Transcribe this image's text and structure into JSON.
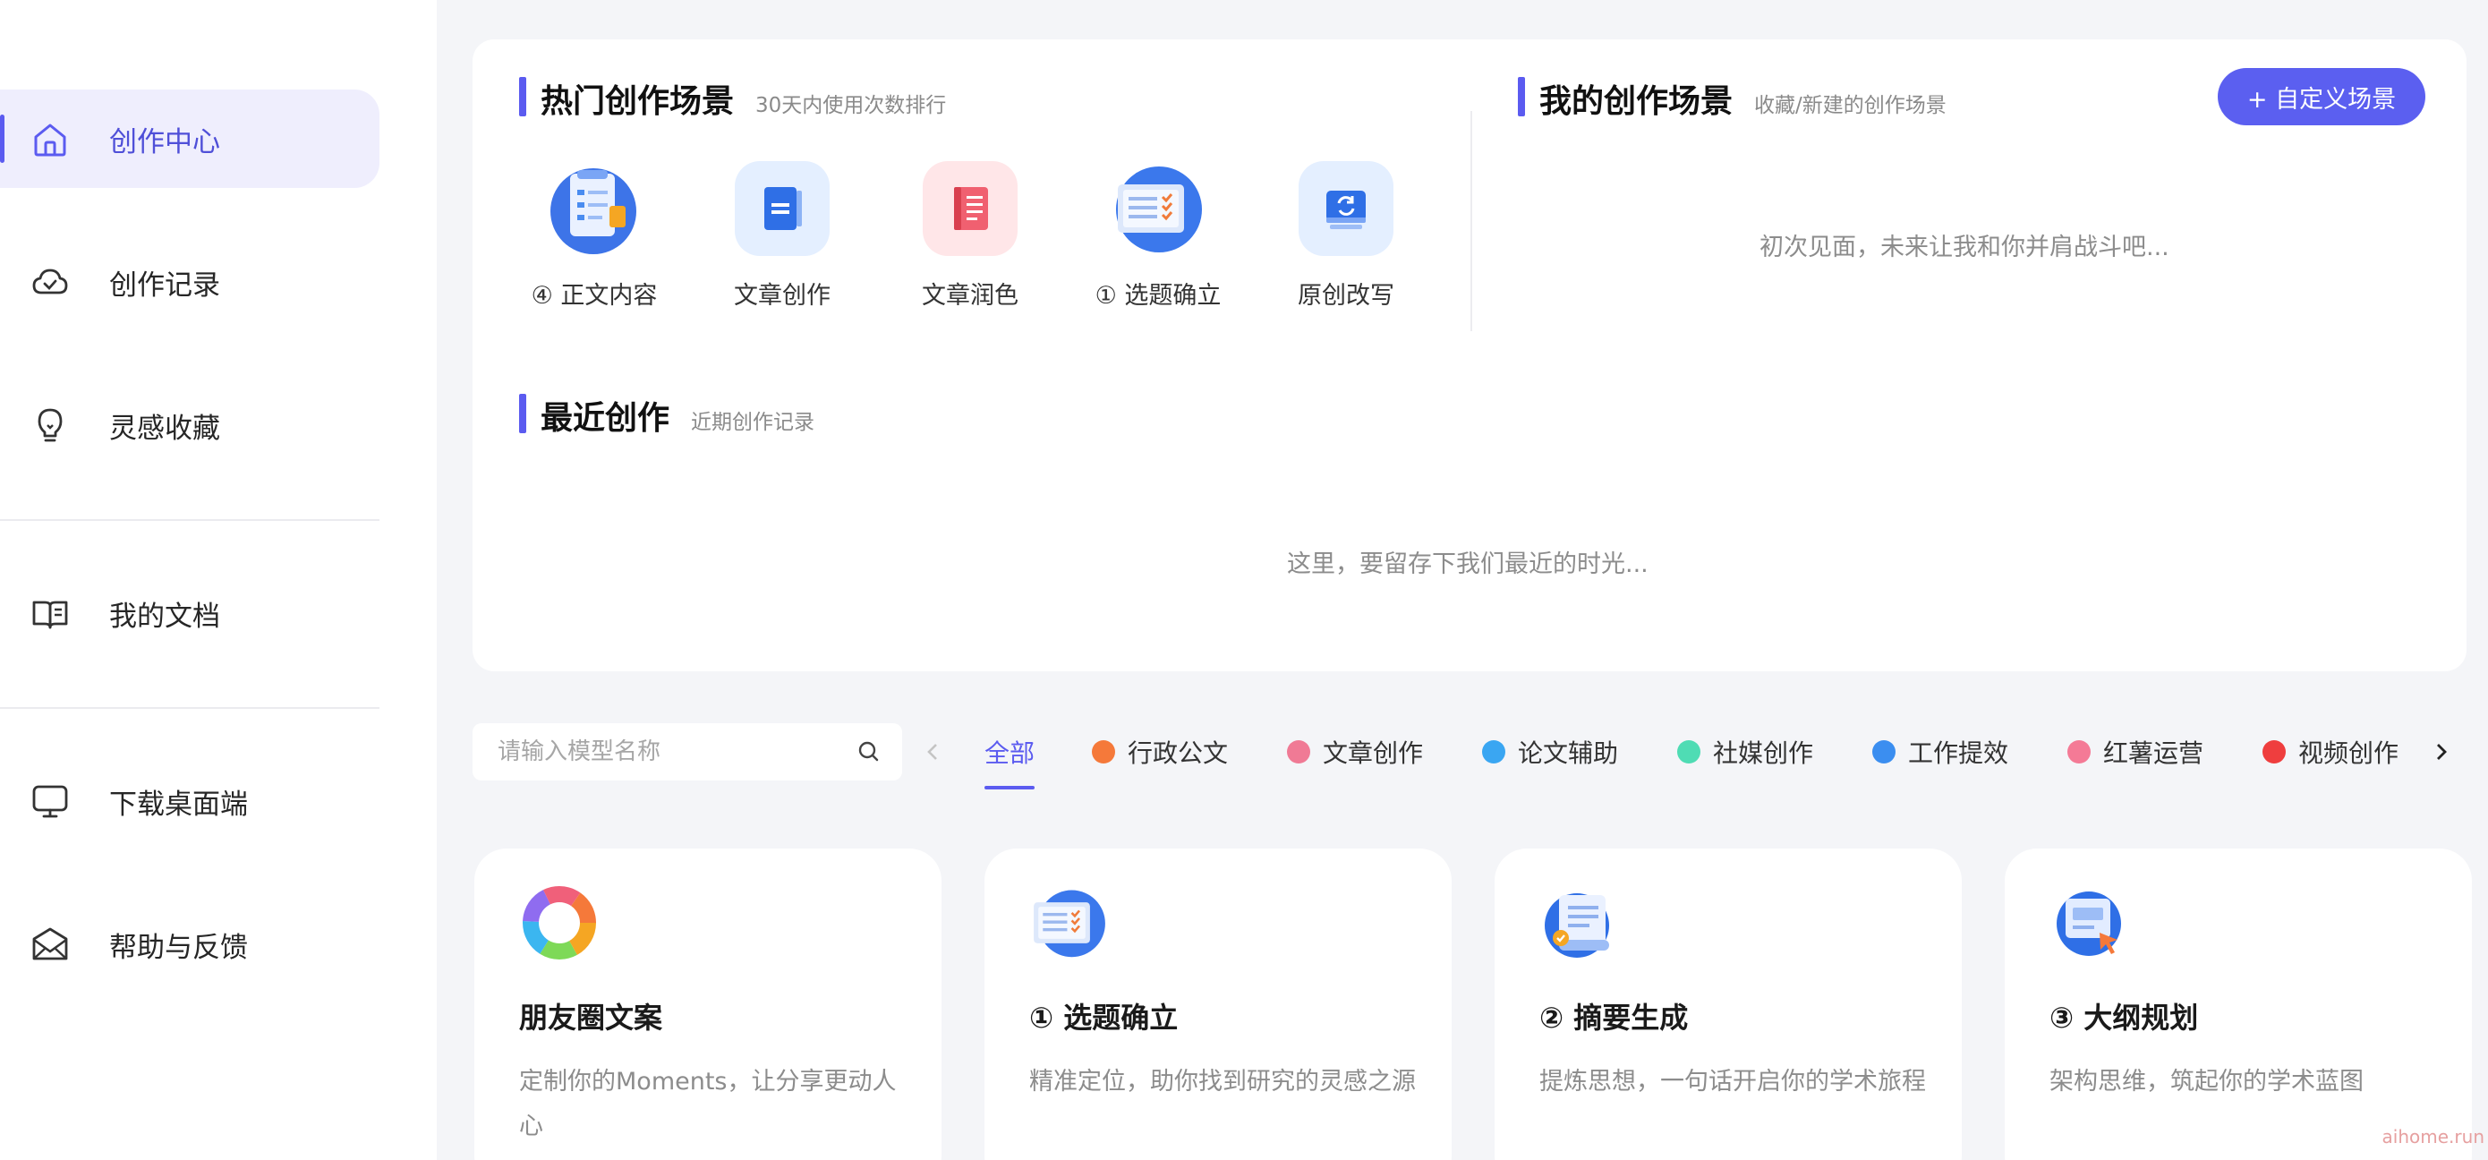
{
  "sidebar": {
    "items": [
      {
        "label": "创作中心",
        "icon": "home-icon",
        "active": true
      },
      {
        "label": "创作记录",
        "icon": "cloud-icon"
      },
      {
        "label": "灵感收藏",
        "icon": "lightbulb-icon"
      },
      {
        "label": "我的文档",
        "icon": "document-book-icon"
      },
      {
        "label": "下载桌面端",
        "icon": "monitor-icon"
      },
      {
        "label": "帮助与反馈",
        "icon": "mail-feedback-icon"
      }
    ]
  },
  "hot_scenes": {
    "title": "热门创作场景",
    "subtitle": "30天内使用次数排行",
    "items": [
      {
        "label": "④ 正文内容",
        "icon": "clipboard-checklist-icon"
      },
      {
        "label": "文章创作",
        "icon": "blue-book-icon"
      },
      {
        "label": "文章润色",
        "icon": "red-book-icon"
      },
      {
        "label": "① 选题确立",
        "icon": "checklist-doc-icon"
      },
      {
        "label": "原创改写",
        "icon": "card-refresh-icon"
      }
    ]
  },
  "my_scenes": {
    "title": "我的创作场景",
    "subtitle": "收藏/新建的创作场景",
    "custom_button": "+ 自定义场景",
    "empty_text": "初次见面，未来让我和你并肩战斗吧..."
  },
  "recent": {
    "title": "最近创作",
    "subtitle": "近期创作记录",
    "empty_text": "这里，要留存下我们最近的时光..."
  },
  "search": {
    "placeholder": "请输入模型名称"
  },
  "categories": [
    {
      "label": "全部",
      "active": true
    },
    {
      "label": "行政公文",
      "color": "#f5793a"
    },
    {
      "label": "文章创作",
      "color": "#f07a95"
    },
    {
      "label": "论文辅助",
      "color": "#3aa6f2"
    },
    {
      "label": "社媒创作",
      "color": "#4fdcb4"
    },
    {
      "label": "工作提效",
      "color": "#3b8ef0"
    },
    {
      "label": "红薯运营",
      "color": "#f47a96"
    },
    {
      "label": "视频创作",
      "color": "#ef3e3e"
    }
  ],
  "cards": [
    {
      "title": "朋友圈文案",
      "desc": "定制你的Moments，让分享更动人心",
      "icon": "rainbow-ring-icon"
    },
    {
      "title": "① 选题确立",
      "desc": "精准定位，助你找到研究的灵感之源",
      "icon": "checklist-doc-icon"
    },
    {
      "title": "② 摘要生成",
      "desc": "提炼思想，一句话开启你的学术旅程",
      "icon": "scroll-doc-icon"
    },
    {
      "title": "③ 大纲规划",
      "desc": "架构思维，筑起你的学术蓝图",
      "icon": "outline-cursor-icon"
    }
  ],
  "watermark": "aihome.run",
  "colors": {
    "accent": "#5b5bf0",
    "button": "#5b5ff0"
  }
}
